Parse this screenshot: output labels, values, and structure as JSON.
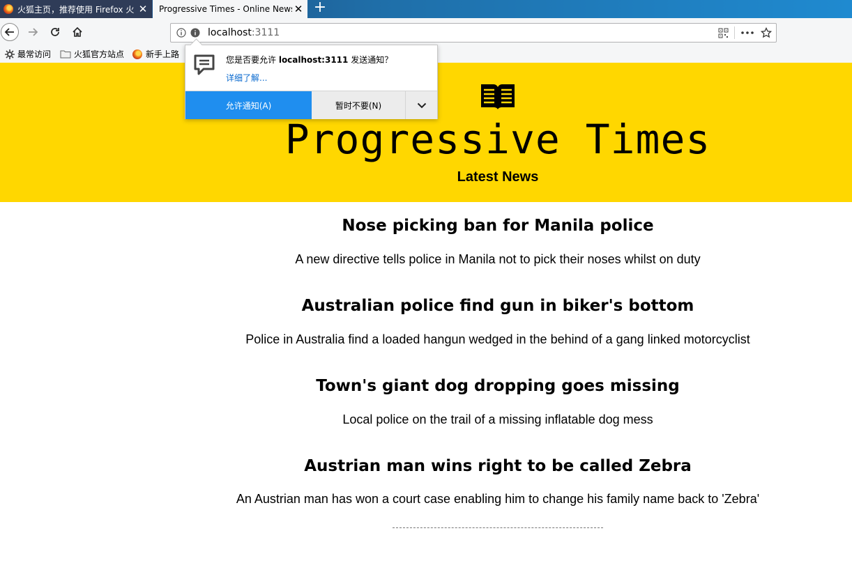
{
  "browser": {
    "tabs": [
      {
        "title": "火狐主页，推荐使用 Firefox 火",
        "active": false
      },
      {
        "title": "Progressive Times - Online News",
        "active": true
      }
    ],
    "url_host": "localhost",
    "url_port": ":3111",
    "bookmarks": [
      {
        "label": "最常访问",
        "icon": "gear-icon"
      },
      {
        "label": "火狐官方站点",
        "icon": "folder-icon"
      },
      {
        "label": "新手上路",
        "icon": "firefox-icon"
      }
    ]
  },
  "notification": {
    "message_prefix": "您是否要允许 ",
    "message_host": "localhost:3111",
    "message_suffix": " 发送通知？",
    "learn_more": "详细了解...",
    "allow_label": "允许通知(A)",
    "deny_label": "暂时不要(N)"
  },
  "site": {
    "title": "Progressive Times",
    "subtitle": "Latest News",
    "accent_color": "#ffd700"
  },
  "articles": [
    {
      "headline": "Nose picking ban for Manila police",
      "summary": "A new directive tells police in Manila not to pick their noses whilst on duty"
    },
    {
      "headline": "Australian police find gun in biker's bottom",
      "summary": "Police in Australia find a loaded hangun wedged in the behind of a gang linked motorcyclist"
    },
    {
      "headline": "Town's giant dog dropping goes missing",
      "summary": "Local police on the trail of a missing inflatable dog mess"
    },
    {
      "headline": "Austrian man wins right to be called Zebra",
      "summary": "An Austrian man has won a court case enabling him to change his family name back to 'Zebra'"
    }
  ]
}
